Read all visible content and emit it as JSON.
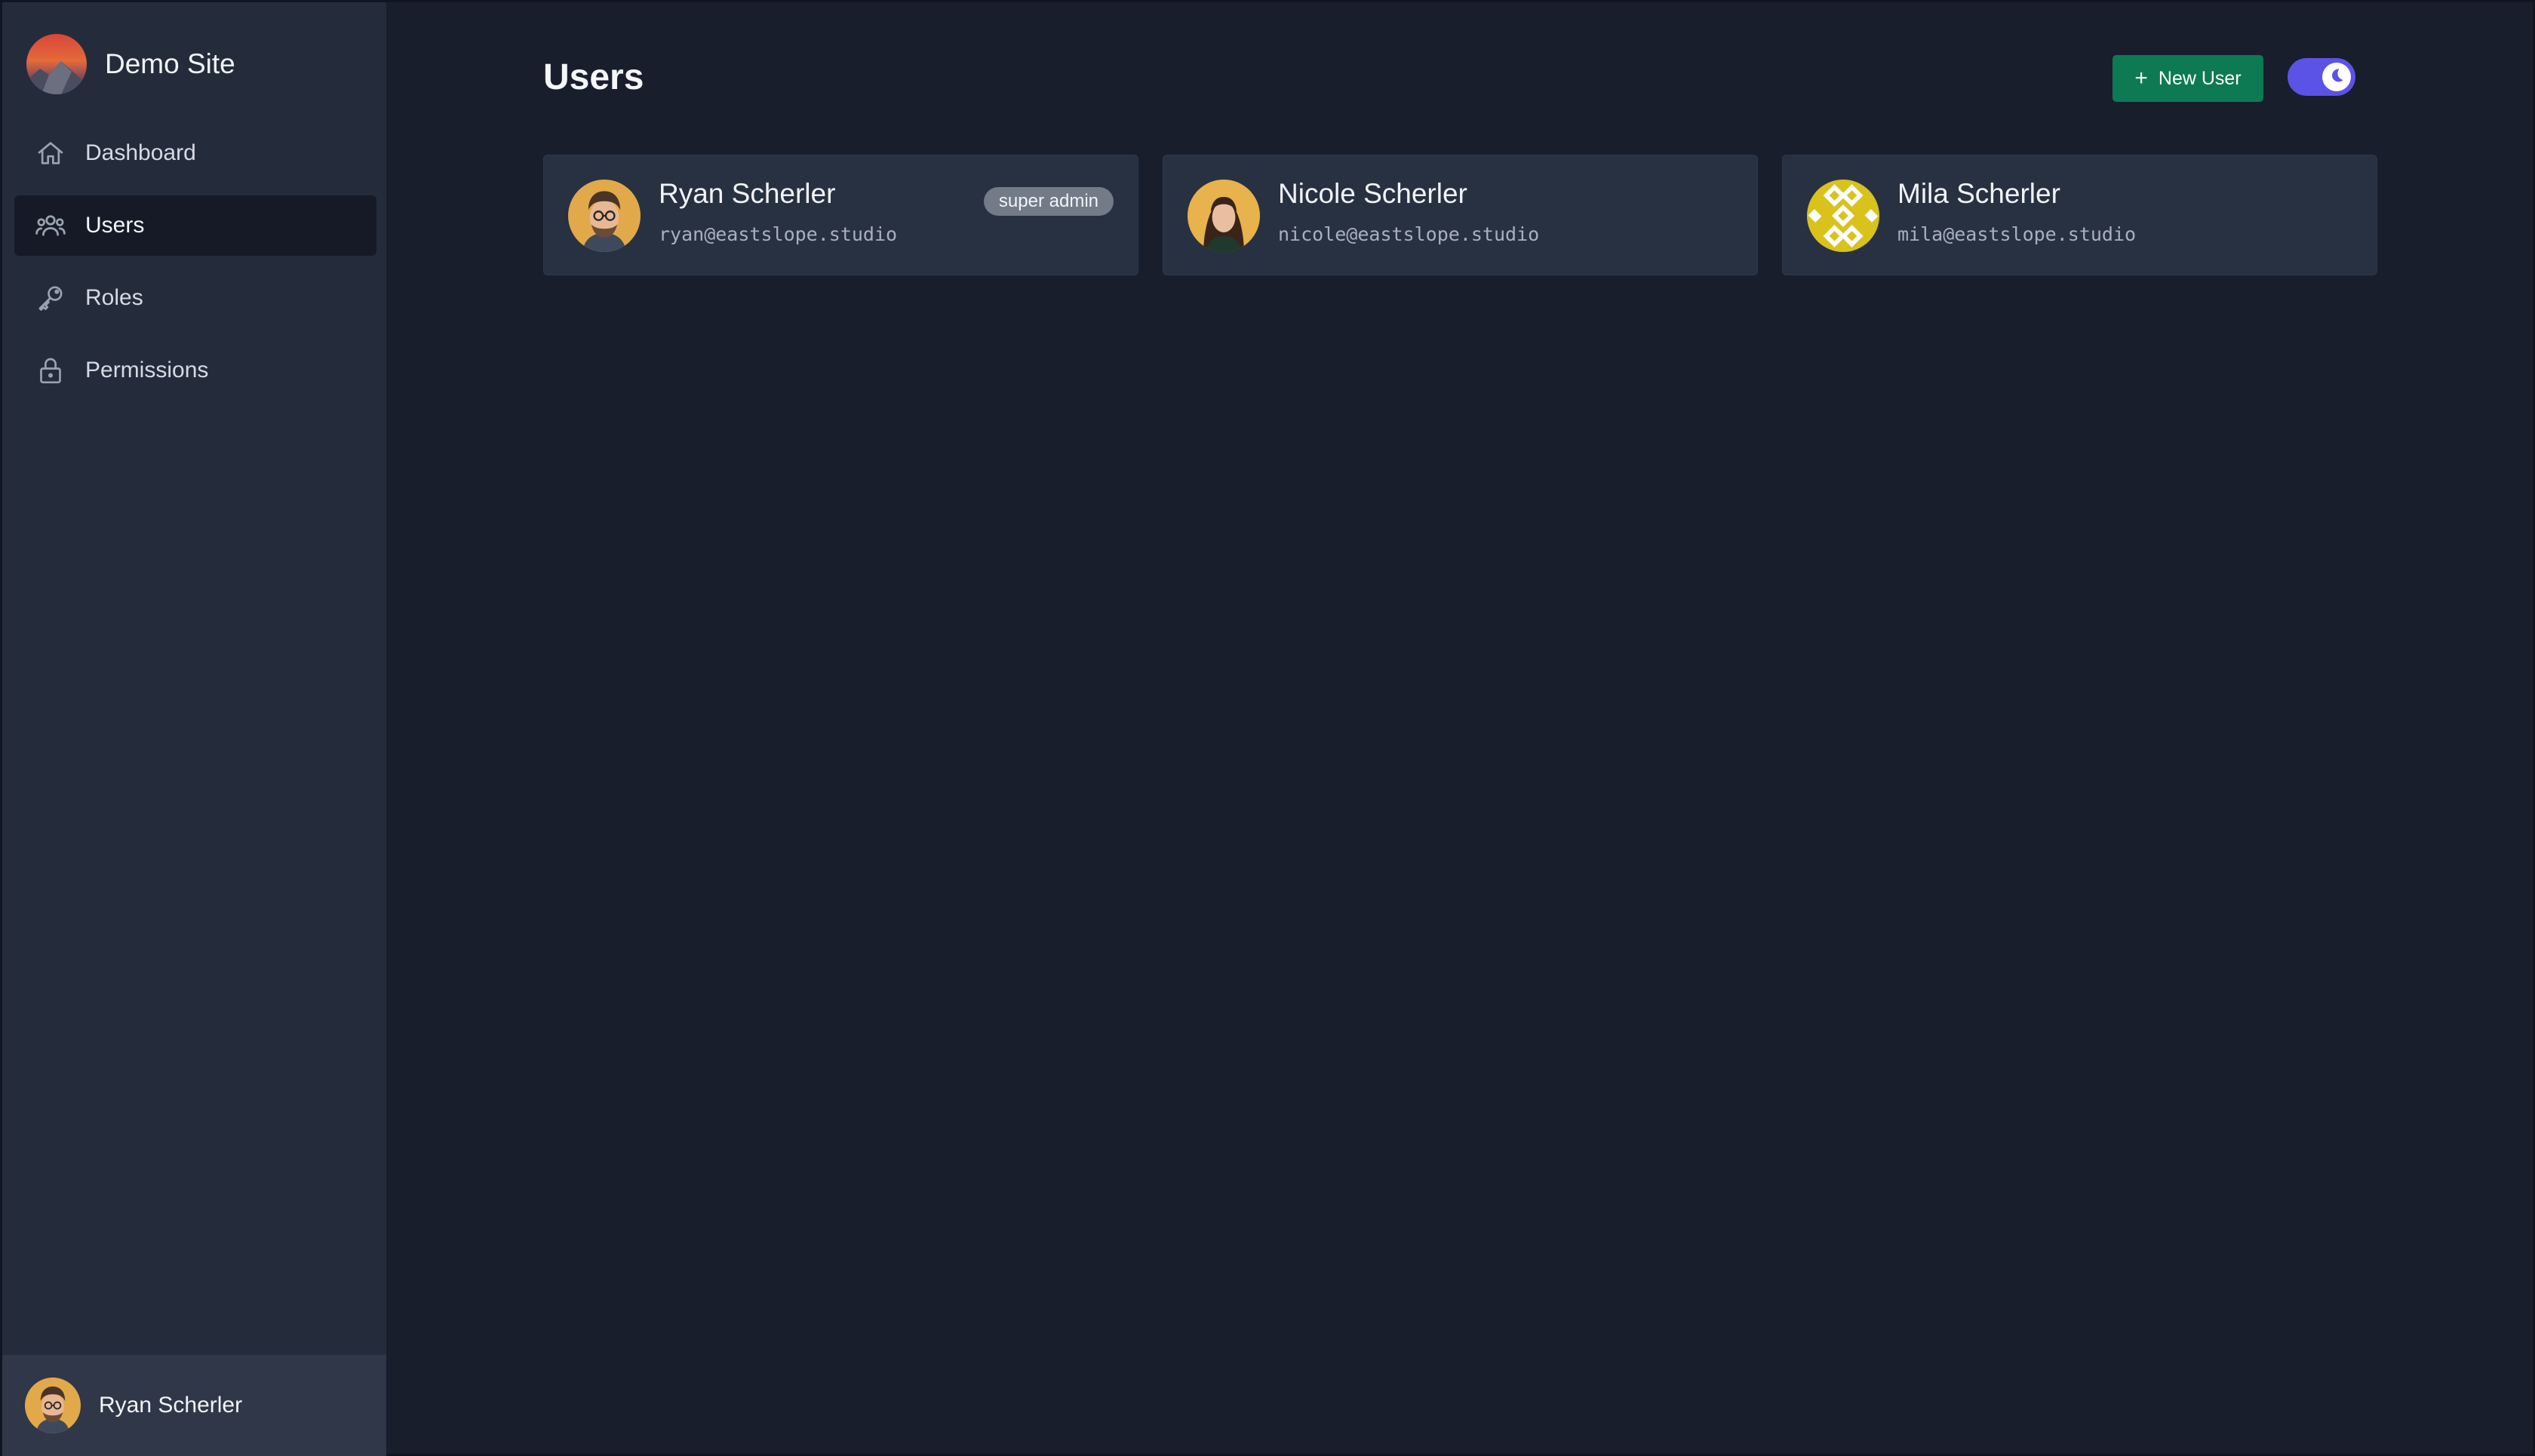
{
  "brand": {
    "name": "Demo Site",
    "icon": "mountain-sunset-logo"
  },
  "sidebar": {
    "items": [
      {
        "label": "Dashboard",
        "icon": "home-icon",
        "active": false
      },
      {
        "label": "Users",
        "icon": "users-icon",
        "active": true
      },
      {
        "label": "Roles",
        "icon": "key-icon",
        "active": false
      },
      {
        "label": "Permissions",
        "icon": "lock-icon",
        "active": false
      }
    ],
    "footer": {
      "name": "Ryan Scherler"
    }
  },
  "header": {
    "title": "Users",
    "new_user_label": "New User",
    "new_user_icon": "plus-icon",
    "theme_toggle": {
      "state": "dark",
      "icon": "moon-icon"
    }
  },
  "users": [
    {
      "name": "Ryan Scherler",
      "email": "ryan@eastslope.studio",
      "badge": "super admin"
    },
    {
      "name": "Nicole Scherler",
      "email": "nicole@eastslope.studio",
      "badge": ""
    },
    {
      "name": "Mila Scherler",
      "email": "mila@eastslope.studio",
      "badge": ""
    }
  ],
  "colors": {
    "background": "#181e2c",
    "sidebar": "#242c3c",
    "card": "#283142",
    "primary_button": "#0e7a53",
    "toggle": "#5b53e6",
    "badge": "#737b89"
  }
}
